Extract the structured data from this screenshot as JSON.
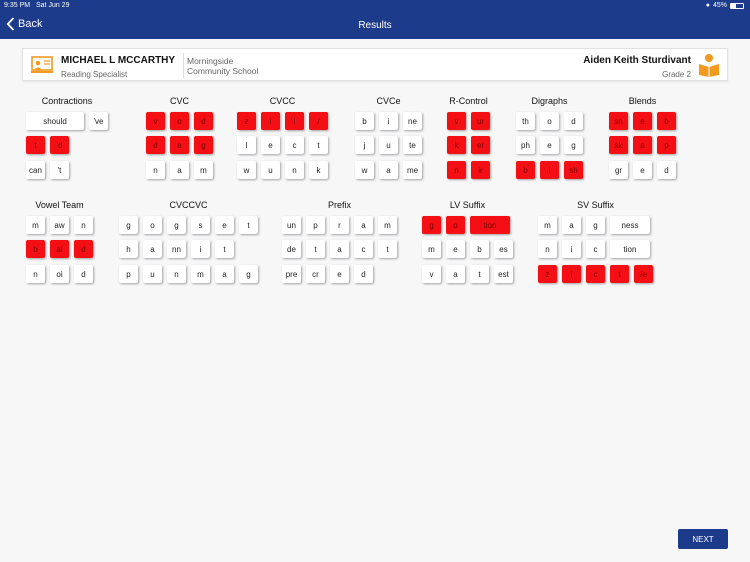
{
  "status": {
    "time": "9:35 PM",
    "date": "Sat Jun 29",
    "battery": "45%",
    "battery_level": 0.45
  },
  "nav": {
    "back_label": "Back",
    "title": "Results"
  },
  "info": {
    "teacher_name": "MICHAEL L MCCARTHY",
    "teacher_role": "Reading Specialist",
    "school": "Morningside Community School",
    "student_name": "Aiden Keith Sturdivant",
    "student_grade": "Grade 2"
  },
  "groups": [
    {
      "name": "Contractions",
      "rows": [
        [
          [
            "should",
            false
          ],
          [
            "'ve",
            false
          ]
        ],
        [
          [
            "t",
            true
          ],
          [
            "'d",
            true
          ]
        ],
        [
          [
            "can",
            false
          ],
          [
            "'t",
            false
          ]
        ]
      ]
    },
    {
      "name": "CVC",
      "rows": [
        [
          [
            "v",
            true
          ],
          [
            "o",
            true
          ],
          [
            "d",
            true
          ]
        ],
        [
          [
            "d",
            true
          ],
          [
            "a",
            true
          ],
          [
            "g",
            true
          ]
        ],
        [
          [
            "n",
            false
          ],
          [
            "a",
            false
          ],
          [
            "m",
            false
          ]
        ]
      ]
    },
    {
      "name": "CVCC",
      "rows": [
        [
          [
            "z",
            true
          ],
          [
            "i",
            true
          ],
          [
            "l",
            true
          ],
          [
            "/",
            true
          ]
        ],
        [
          [
            "l",
            false
          ],
          [
            "e",
            false
          ],
          [
            "c",
            false
          ],
          [
            "t",
            false
          ]
        ],
        [
          [
            "w",
            false
          ],
          [
            "u",
            false
          ],
          [
            "n",
            false
          ],
          [
            "k",
            false
          ]
        ]
      ]
    },
    {
      "name": "CVCe",
      "rows": [
        [
          [
            "b",
            false
          ],
          [
            "i",
            false
          ],
          [
            "ne",
            false
          ]
        ],
        [
          [
            "j",
            false
          ],
          [
            "u",
            false
          ],
          [
            "te",
            false
          ]
        ],
        [
          [
            "w",
            false
          ],
          [
            "a",
            false
          ],
          [
            "me",
            false
          ]
        ]
      ]
    },
    {
      "name": "R-Control",
      "rows": [
        [
          [
            "v",
            true
          ],
          [
            "ur",
            true
          ]
        ],
        [
          [
            "k",
            true
          ],
          [
            "er",
            true
          ]
        ],
        [
          [
            "n",
            true
          ],
          [
            "ir",
            true
          ]
        ]
      ]
    },
    {
      "name": "Digraphs",
      "rows": [
        [
          [
            "th",
            false
          ],
          [
            "o",
            false
          ],
          [
            "d",
            false
          ]
        ],
        [
          [
            "ph",
            false
          ],
          [
            "e",
            false
          ],
          [
            "g",
            false
          ]
        ],
        [
          [
            "b",
            true
          ],
          [
            "i",
            true
          ],
          [
            "sh",
            true
          ]
        ]
      ]
    },
    {
      "name": "Blends",
      "rows": [
        [
          [
            "sn",
            true
          ],
          [
            "e",
            true
          ],
          [
            "b",
            true
          ]
        ],
        [
          [
            "sk",
            true
          ],
          [
            "a",
            true
          ],
          [
            "p",
            true
          ]
        ],
        [
          [
            "gr",
            false
          ],
          [
            "e",
            false
          ],
          [
            "d",
            false
          ]
        ]
      ]
    },
    {
      "name": "Vowel Team",
      "rows": [
        [
          [
            "m",
            false
          ],
          [
            "aw",
            false
          ],
          [
            "n",
            false
          ]
        ],
        [
          [
            "b",
            true
          ],
          [
            "ai",
            true
          ],
          [
            "d",
            true
          ]
        ],
        [
          [
            "n",
            false
          ],
          [
            "oi",
            false
          ],
          [
            "d",
            false
          ]
        ]
      ]
    },
    {
      "name": "CVCCVC",
      "rows": [
        [
          [
            "g",
            false
          ],
          [
            "o",
            false
          ],
          [
            "g",
            false
          ],
          [
            "s",
            false
          ],
          [
            "e",
            false
          ],
          [
            "t",
            false
          ]
        ],
        [
          [
            "h",
            false
          ],
          [
            "a",
            false
          ],
          [
            "nn",
            false
          ],
          [
            "i",
            false
          ],
          [
            "t",
            false
          ]
        ],
        [
          [
            "p",
            false
          ],
          [
            "u",
            false
          ],
          [
            "n",
            false
          ],
          [
            "m",
            false
          ],
          [
            "a",
            false
          ],
          [
            "g",
            false
          ]
        ]
      ]
    },
    {
      "name": "Prefix",
      "rows": [
        [
          [
            "un",
            false
          ],
          [
            "p",
            false
          ],
          [
            "r",
            false
          ],
          [
            "a",
            false
          ],
          [
            "m",
            false
          ]
        ],
        [
          [
            "de",
            false
          ],
          [
            "t",
            false
          ],
          [
            "a",
            false
          ],
          [
            "c",
            false
          ],
          [
            "t",
            false
          ]
        ],
        [
          [
            "pre",
            false
          ],
          [
            "cr",
            false
          ],
          [
            "e",
            false
          ],
          [
            "d",
            false
          ]
        ]
      ]
    },
    {
      "name": "LV Suffix",
      "rows": [
        [
          [
            "g",
            true
          ],
          [
            "o",
            true
          ],
          [
            "tion",
            true
          ]
        ],
        [
          [
            "m",
            false
          ],
          [
            "e",
            false
          ],
          [
            "b",
            false
          ],
          [
            "es",
            false
          ]
        ],
        [
          [
            "v",
            false
          ],
          [
            "a",
            false
          ],
          [
            "t",
            false
          ],
          [
            "est",
            false
          ]
        ]
      ]
    },
    {
      "name": "SV Suffix",
      "rows": [
        [
          [
            "m",
            false
          ],
          [
            "a",
            false
          ],
          [
            "g",
            false
          ],
          [
            "ness",
            false
          ]
        ],
        [
          [
            "n",
            false
          ],
          [
            "i",
            false
          ],
          [
            "c",
            false
          ],
          [
            "tion",
            false
          ]
        ],
        [
          [
            "z",
            true
          ],
          [
            "i",
            true
          ],
          [
            "c",
            true
          ],
          [
            "t",
            true
          ],
          [
            "/e",
            true
          ]
        ]
      ]
    }
  ],
  "next_label": "NEXT",
  "colors": {
    "brand": "#1d3b8b",
    "miss": "#f30f13",
    "icon_orange": "#f29a1f"
  }
}
